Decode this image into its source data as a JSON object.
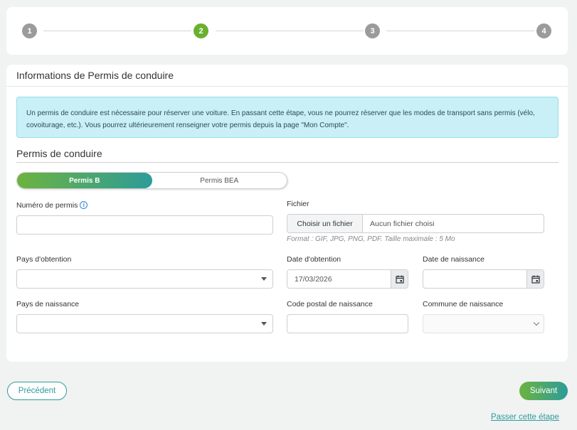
{
  "stepper": {
    "steps": [
      "1",
      "2",
      "3",
      "4"
    ],
    "active_step": 2,
    "active_color": "#6ab02f",
    "inactive_color": "#9b9b9b"
  },
  "card": {
    "title": "Informations de Permis de conduire",
    "info": "Un permis de conduire est nécessaire pour réserver une voiture. En passant cette étape, vous ne pourrez réserver que les modes de transport sans permis (vélo, covoiturage, etc.). Vous pourrez ultérieurement renseigner votre permis depuis la page \"Mon Compte\".",
    "section_title": "Permis de conduire"
  },
  "toggle": {
    "options": [
      "Permis B",
      "Permis BEA"
    ],
    "selected": "Permis B"
  },
  "fields": {
    "numero_permis": {
      "label": "Numéro de permis",
      "value": ""
    },
    "fichier": {
      "label": "Fichier",
      "button": "Choisir un fichier",
      "status": "Aucun fichier choisi",
      "hint": "Format : GIF, JPG, PNG, PDF. Taille maximale : 5 Mo"
    },
    "pays_obtention": {
      "label": "Pays d'obtention",
      "value": ""
    },
    "date_obtention": {
      "label": "Date d'obtention",
      "value": "17/03/2026"
    },
    "date_naissance": {
      "label": "Date de naissance",
      "value": ""
    },
    "pays_naissance": {
      "label": "Pays de naissance",
      "value": ""
    },
    "code_postal_naissance": {
      "label": "Code postal de naissance",
      "value": ""
    },
    "commune_naissance": {
      "label": "Commune de naissance",
      "value": ""
    }
  },
  "actions": {
    "previous": "Précédent",
    "next": "Suivant",
    "skip": "Passer cette étape"
  },
  "icons": {
    "info": "info-icon",
    "calendar": "calendar-icon",
    "dropdown": "caret-down-icon",
    "chevron": "chevron-down-icon"
  }
}
